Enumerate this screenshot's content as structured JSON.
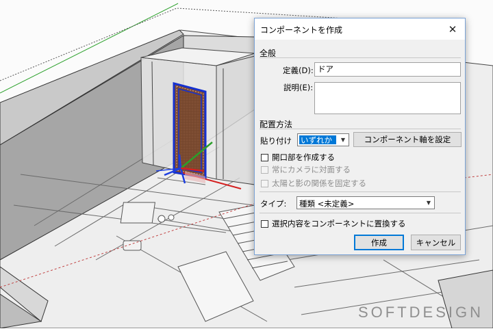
{
  "dialog": {
    "title": "コンポーネントを作成",
    "general": {
      "heading": "全般",
      "definition_label": "定義(D):",
      "definition_value": "ドア",
      "description_label": "説明(E):",
      "description_value": ""
    },
    "placement": {
      "heading": "配置方法",
      "glue_label": "貼り付け",
      "glue_value": "いずれか",
      "set_axes_label": "コンポーネント軸を設定",
      "cut_opening_label": "開口部を作成する",
      "face_camera_label": "常にカメラに対面する",
      "shadows_label": "太陽と影の関係を固定する"
    },
    "type": {
      "label": "タイプ:",
      "value": "種類 <未定義>"
    },
    "replace_label": "選択内容をコンポーネントに置換する",
    "create_label": "作成",
    "cancel_label": "キャンセル"
  },
  "watermark": "SOFTDESIGN",
  "colors": {
    "x_axis": "#d42020",
    "y_axis": "#2aa02a",
    "z_axis": "#1c3ee0",
    "door_fill": "#7a4a30",
    "selection": "#1530d0",
    "accent": "#0078d7"
  },
  "icons": [
    "close-icon",
    "dropdown-arrow-icon",
    "checkbox-icon"
  ]
}
